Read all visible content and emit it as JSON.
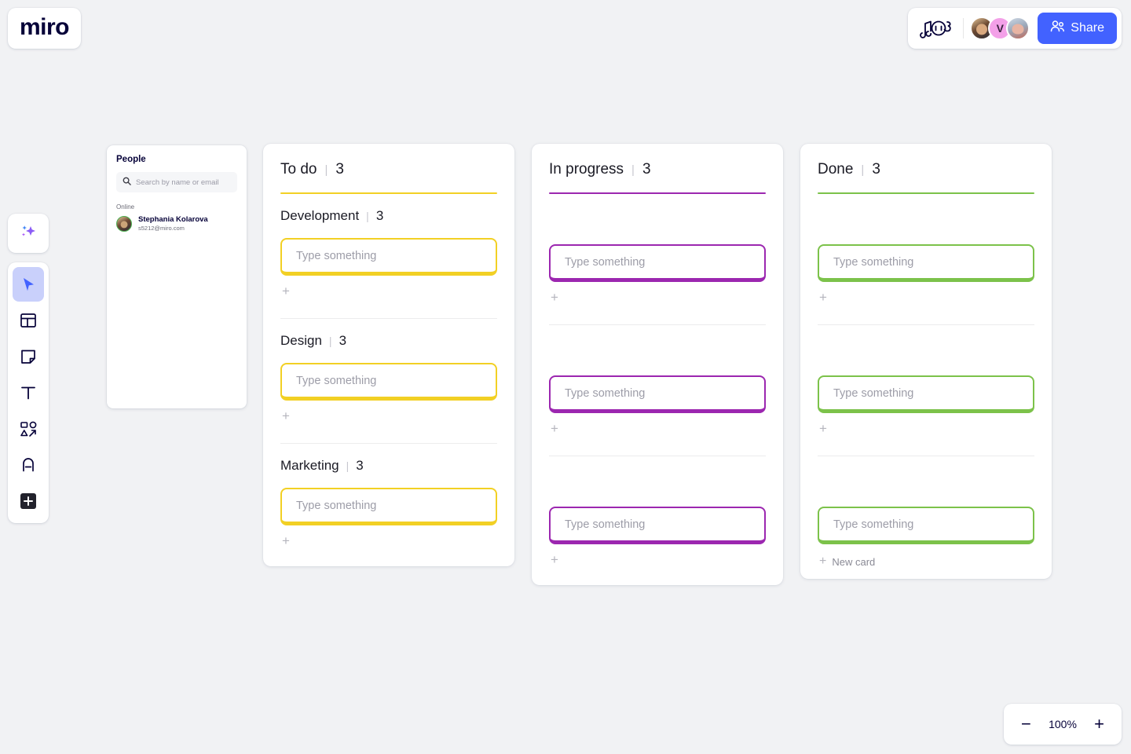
{
  "app": {
    "logo_text": "miro",
    "background_color": "#f1f2f4"
  },
  "topbar": {
    "doodle_icon": "music-doodle-icon",
    "avatars": [
      {
        "name": "avatar-1",
        "initial": ""
      },
      {
        "name": "avatar-2",
        "initial": "V"
      },
      {
        "name": "avatar-3",
        "initial": ""
      }
    ],
    "share_label": "Share",
    "share_icon": "people-icon",
    "share_color": "#4262ff"
  },
  "toolbar": {
    "items": [
      {
        "name": "ai-sparkle",
        "label": "AI"
      },
      {
        "name": "cursor",
        "label": "Select",
        "active": true
      },
      {
        "name": "templates",
        "label": "Templates"
      },
      {
        "name": "sticky-note",
        "label": "Sticky note"
      },
      {
        "name": "text",
        "label": "Text"
      },
      {
        "name": "shapes",
        "label": "Shapes and connectors"
      },
      {
        "name": "pen",
        "label": "Pen"
      },
      {
        "name": "more",
        "label": "More apps"
      }
    ]
  },
  "people_panel": {
    "title": "People",
    "search_placeholder": "Search by name or email",
    "search_value": "",
    "search_icon": "search-icon",
    "online_label": "Online",
    "people": [
      {
        "name": "Stephania Kolarova",
        "email": "s5212@miro.com"
      }
    ]
  },
  "board": {
    "card_placeholder": "Type something",
    "add_symbol": "+",
    "new_card_label": "New card",
    "columns": [
      {
        "title": "To do",
        "count": "3",
        "separator": "|",
        "color": "#f2d024",
        "sections": [
          {
            "title": "Development",
            "count": "3",
            "separator": "|",
            "cards": [
              ""
            ]
          },
          {
            "title": "Design",
            "count": "3",
            "separator": "|",
            "cards": [
              ""
            ]
          },
          {
            "title": "Marketing",
            "count": "3",
            "separator": "|",
            "cards": [
              ""
            ]
          }
        ],
        "has_new_card": false
      },
      {
        "title": "In progress",
        "count": "3",
        "separator": "|",
        "color": "#9c27b0",
        "sections": [
          {
            "title": "",
            "count": "",
            "separator": "",
            "cards": [
              ""
            ]
          },
          {
            "title": "",
            "count": "",
            "separator": "",
            "cards": [
              ""
            ]
          },
          {
            "title": "",
            "count": "",
            "separator": "",
            "cards": [
              ""
            ]
          }
        ],
        "has_new_card": false
      },
      {
        "title": "Done",
        "count": "3",
        "separator": "|",
        "color": "#7cc24a",
        "sections": [
          {
            "title": "",
            "count": "",
            "separator": "",
            "cards": [
              ""
            ]
          },
          {
            "title": "",
            "count": "",
            "separator": "",
            "cards": [
              ""
            ]
          },
          {
            "title": "",
            "count": "",
            "separator": "",
            "cards": [
              ""
            ]
          }
        ],
        "has_new_card": true
      }
    ]
  },
  "zoom": {
    "minus_label": "−",
    "value": "100%",
    "plus_label": "+"
  }
}
